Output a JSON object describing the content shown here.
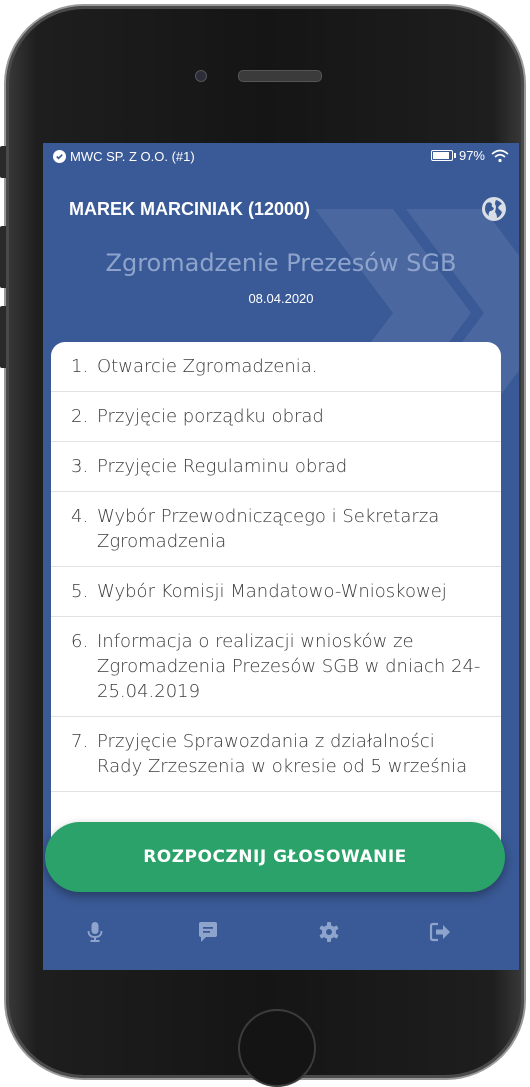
{
  "status": {
    "organization": "MWC SP. Z O.O. (#1)",
    "battery_percent": "97%",
    "battery_level": 0.97
  },
  "header": {
    "user": "MAREK MARCINIAK (12000)",
    "meeting_title": "Zgromadzenie Prezesów SGB",
    "meeting_date": "08.04.2020"
  },
  "agenda": [
    {
      "num": "1.",
      "text": "Otwarcie Zgromadzenia."
    },
    {
      "num": "2.",
      "text": "Przyjęcie porządku obrad"
    },
    {
      "num": "3.",
      "text": "Przyjęcie Regulaminu obrad"
    },
    {
      "num": "4.",
      "text": "Wybór Przewodniczącego i Sekretarza Zgromadzenia"
    },
    {
      "num": "5.",
      "text": "Wybór Komisji Mandatowo-Wnioskowej"
    },
    {
      "num": "6.",
      "text": "Informacja o realizacji wniosków ze Zgromadzenia Prezesów SGB w dniach 24-25.04.2019"
    },
    {
      "num": "7.",
      "text": "Przyjęcie Sprawozdania z działalności Rady Zrzeszenia w okresie od 5 września"
    }
  ],
  "actions": {
    "start_voting": "ROZPOCZNIJ GŁOSOWANIE"
  },
  "nav": {
    "icons": [
      "microphone-icon",
      "chat-icon",
      "settings-icon",
      "logout-icon"
    ]
  },
  "colors": {
    "screen_bg": "#3a5a97",
    "accent_green": "#2aa26a",
    "title_muted": "#8ea4cc"
  }
}
